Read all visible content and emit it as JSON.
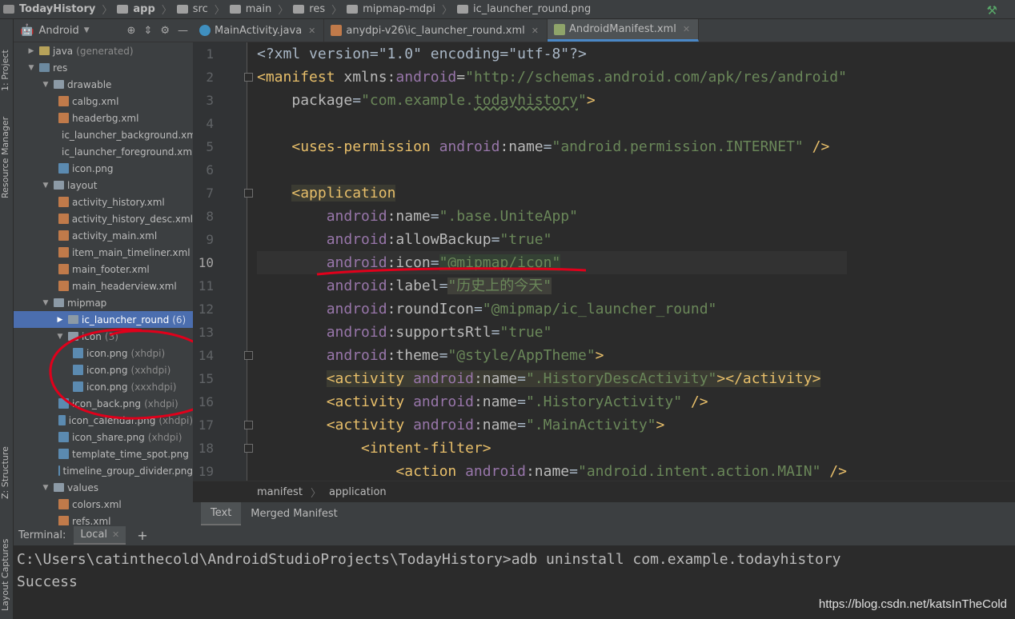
{
  "breadcrumbs": [
    "TodayHistory",
    "app",
    "src",
    "main",
    "res",
    "mipmap-mdpi",
    "ic_launcher_round.png"
  ],
  "left_strip": {
    "project": "1: Project",
    "resource_manager": "Resource Manager",
    "structure": "Z: Structure",
    "layout_captures": "Layout Captures"
  },
  "project_panel": {
    "view_mode": "Android",
    "tree": [
      {
        "label": "java",
        "suffix": "(generated)",
        "depth": 1,
        "arrow": "right",
        "icon": "java"
      },
      {
        "label": "res",
        "depth": 1,
        "arrow": "down",
        "icon": "res"
      },
      {
        "label": "drawable",
        "depth": 2,
        "arrow": "down",
        "icon": "folder"
      },
      {
        "label": "calbg.xml",
        "depth": 3,
        "icon": "xml"
      },
      {
        "label": "headerbg.xml",
        "depth": 3,
        "icon": "xml"
      },
      {
        "label": "ic_launcher_background.xml",
        "depth": 3,
        "icon": "xml"
      },
      {
        "label": "ic_launcher_foreground.xml",
        "depth": 3,
        "icon": "xml"
      },
      {
        "label": "icon.png",
        "depth": 3,
        "icon": "png"
      },
      {
        "label": "layout",
        "depth": 2,
        "arrow": "down",
        "icon": "folder"
      },
      {
        "label": "activity_history.xml",
        "depth": 3,
        "icon": "xml"
      },
      {
        "label": "activity_history_desc.xml",
        "depth": 3,
        "icon": "xml"
      },
      {
        "label": "activity_main.xml",
        "depth": 3,
        "icon": "xml"
      },
      {
        "label": "item_main_timeliner.xml",
        "depth": 3,
        "icon": "xml"
      },
      {
        "label": "main_footer.xml",
        "depth": 3,
        "icon": "xml"
      },
      {
        "label": "main_headerview.xml",
        "depth": 3,
        "icon": "xml"
      },
      {
        "label": "mipmap",
        "depth": 2,
        "arrow": "down",
        "icon": "folder"
      },
      {
        "label": "ic_launcher_round",
        "suffix": "(6)",
        "depth": 3,
        "arrow": "right",
        "icon": "folder",
        "selected": true
      },
      {
        "label": "icon",
        "suffix": "(3)",
        "depth": 3,
        "arrow": "down",
        "icon": "folder"
      },
      {
        "label": "icon.png",
        "suffix": "(xhdpi)",
        "depth": 4,
        "icon": "png"
      },
      {
        "label": "icon.png",
        "suffix": "(xxhdpi)",
        "depth": 4,
        "icon": "png"
      },
      {
        "label": "icon.png",
        "suffix": "(xxxhdpi)",
        "depth": 4,
        "icon": "png"
      },
      {
        "label": "icon_back.png",
        "suffix": "(xhdpi)",
        "depth": 3,
        "icon": "png"
      },
      {
        "label": "icon_calendar.png",
        "suffix": "(xhdpi)",
        "depth": 3,
        "icon": "png"
      },
      {
        "label": "icon_share.png",
        "suffix": "(xhdpi)",
        "depth": 3,
        "icon": "png"
      },
      {
        "label": "template_time_spot.png",
        "depth": 3,
        "icon": "png"
      },
      {
        "label": "timeline_group_divider.png",
        "depth": 3,
        "icon": "png"
      },
      {
        "label": "values",
        "depth": 2,
        "arrow": "down",
        "icon": "folder"
      },
      {
        "label": "colors.xml",
        "depth": 3,
        "icon": "xml"
      },
      {
        "label": "refs.xml",
        "depth": 3,
        "icon": "xml"
      }
    ]
  },
  "editor_tabs": [
    {
      "label": "MainActivity.java",
      "icon": "java-class-icon",
      "active": false
    },
    {
      "label": "anydpi-v26\\ic_launcher_round.xml",
      "icon": "xml-file-icon",
      "active": false
    },
    {
      "label": "AndroidManifest.xml",
      "icon": "manifest-file-icon",
      "active": true
    }
  ],
  "editor": {
    "line_numbers": [
      "1",
      "2",
      "3",
      "4",
      "5",
      "6",
      "7",
      "8",
      "9",
      "10",
      "11",
      "12",
      "13",
      "14",
      "15",
      "16",
      "17",
      "18",
      "19"
    ],
    "current_line": 10,
    "lines": [
      [
        [
          "pl",
          "<?xml version=\"1.0\" encoding=\"utf-8\"?>"
        ]
      ],
      [
        [
          "tg",
          "<manifest "
        ],
        [
          "at",
          "xmlns:"
        ],
        [
          "ns",
          "android"
        ],
        [
          "at",
          "="
        ],
        [
          "vl",
          "\"http://schemas.android.com/apk/res/android\""
        ]
      ],
      [
        [
          "pl",
          "    "
        ],
        [
          "at",
          "package"
        ],
        [
          "pl",
          "="
        ],
        [
          "vl",
          "\"com.example."
        ],
        [
          "vl und",
          "todayhistory"
        ],
        [
          "vl",
          "\""
        ],
        [
          "tg",
          ">"
        ]
      ],
      [
        [
          "pl",
          ""
        ]
      ],
      [
        [
          "pl",
          "    "
        ],
        [
          "tg",
          "<uses-permission "
        ],
        [
          "ns",
          "android"
        ],
        [
          "at",
          ":name"
        ],
        [
          "pl",
          "="
        ],
        [
          "vl",
          "\"android.permission.INTERNET\""
        ],
        [
          "tg",
          " />"
        ]
      ],
      [
        [
          "pl",
          ""
        ]
      ],
      [
        [
          "pl",
          "    "
        ],
        [
          "tg hl",
          "<application"
        ]
      ],
      [
        [
          "pl",
          "        "
        ],
        [
          "ns",
          "android"
        ],
        [
          "at",
          ":name"
        ],
        [
          "pl",
          "="
        ],
        [
          "vl",
          "\".base.UniteApp\""
        ]
      ],
      [
        [
          "pl",
          "        "
        ],
        [
          "ns",
          "android"
        ],
        [
          "at",
          ":allowBackup"
        ],
        [
          "pl",
          "="
        ],
        [
          "vl",
          "\"true\""
        ]
      ],
      [
        [
          "pl",
          "        "
        ],
        [
          "ns",
          "android"
        ],
        [
          "at",
          ":icon"
        ],
        [
          "pl",
          "="
        ],
        [
          "vl hlstr",
          "\"@mipmap/icon\""
        ]
      ],
      [
        [
          "pl",
          "        "
        ],
        [
          "ns",
          "android"
        ],
        [
          "at",
          ":label"
        ],
        [
          "pl",
          "="
        ],
        [
          "vl cn",
          "\"历史上的今天\""
        ]
      ],
      [
        [
          "pl",
          "        "
        ],
        [
          "ns",
          "android"
        ],
        [
          "at",
          ":roundIcon"
        ],
        [
          "pl",
          "="
        ],
        [
          "vl",
          "\"@mipmap/ic_launcher_round\""
        ]
      ],
      [
        [
          "pl",
          "        "
        ],
        [
          "ns",
          "android"
        ],
        [
          "at",
          ":supportsRtl"
        ],
        [
          "pl",
          "="
        ],
        [
          "vl",
          "\"true\""
        ]
      ],
      [
        [
          "pl",
          "        "
        ],
        [
          "ns",
          "android"
        ],
        [
          "at",
          ":theme"
        ],
        [
          "pl",
          "="
        ],
        [
          "vl",
          "\"@style/AppTheme\""
        ],
        [
          "tg",
          ">"
        ]
      ],
      [
        [
          "pl",
          "        "
        ],
        [
          "tg hl",
          "<activity "
        ],
        [
          "ns hl",
          "android"
        ],
        [
          "at hl",
          ":name"
        ],
        [
          "pl hl",
          "="
        ],
        [
          "vl hl",
          "\".HistoryDescActivity\""
        ],
        [
          "tg hl",
          "></activity>"
        ]
      ],
      [
        [
          "pl",
          "        "
        ],
        [
          "tg",
          "<activity "
        ],
        [
          "ns",
          "android"
        ],
        [
          "at",
          ":name"
        ],
        [
          "pl",
          "="
        ],
        [
          "vl",
          "\".HistoryActivity\""
        ],
        [
          "tg",
          " />"
        ]
      ],
      [
        [
          "pl",
          "        "
        ],
        [
          "tg",
          "<activity "
        ],
        [
          "ns",
          "android"
        ],
        [
          "at",
          ":name"
        ],
        [
          "pl",
          "="
        ],
        [
          "vl",
          "\".MainActivity\""
        ],
        [
          "tg",
          ">"
        ]
      ],
      [
        [
          "pl",
          "            "
        ],
        [
          "tg",
          "<intent-filter>"
        ]
      ],
      [
        [
          "pl",
          "                "
        ],
        [
          "tg",
          "<action "
        ],
        [
          "ns",
          "android"
        ],
        [
          "at",
          ":name"
        ],
        [
          "pl",
          "="
        ],
        [
          "vl",
          "\"android.intent.action.MAIN\""
        ],
        [
          "tg",
          " />"
        ]
      ]
    ]
  },
  "editor_breadcrumb": [
    "manifest",
    "application"
  ],
  "bottom_tabs": [
    {
      "label": "Text",
      "active": true
    },
    {
      "label": "Merged Manifest",
      "active": false
    }
  ],
  "terminal": {
    "label": "Terminal:",
    "tab": "Local",
    "lines": [
      "C:\\Users\\catinthecold\\AndroidStudioProjects\\TodayHistory>adb uninstall com.example.todayhistory",
      "Success"
    ]
  },
  "watermark": "https://blog.csdn.net/katsInTheCold",
  "colors": {
    "selection": "#4b6eaf",
    "tag": "#e8bf6a",
    "string": "#6a8759",
    "namespace": "#9876aa",
    "annotation_red": "#e0001b"
  }
}
